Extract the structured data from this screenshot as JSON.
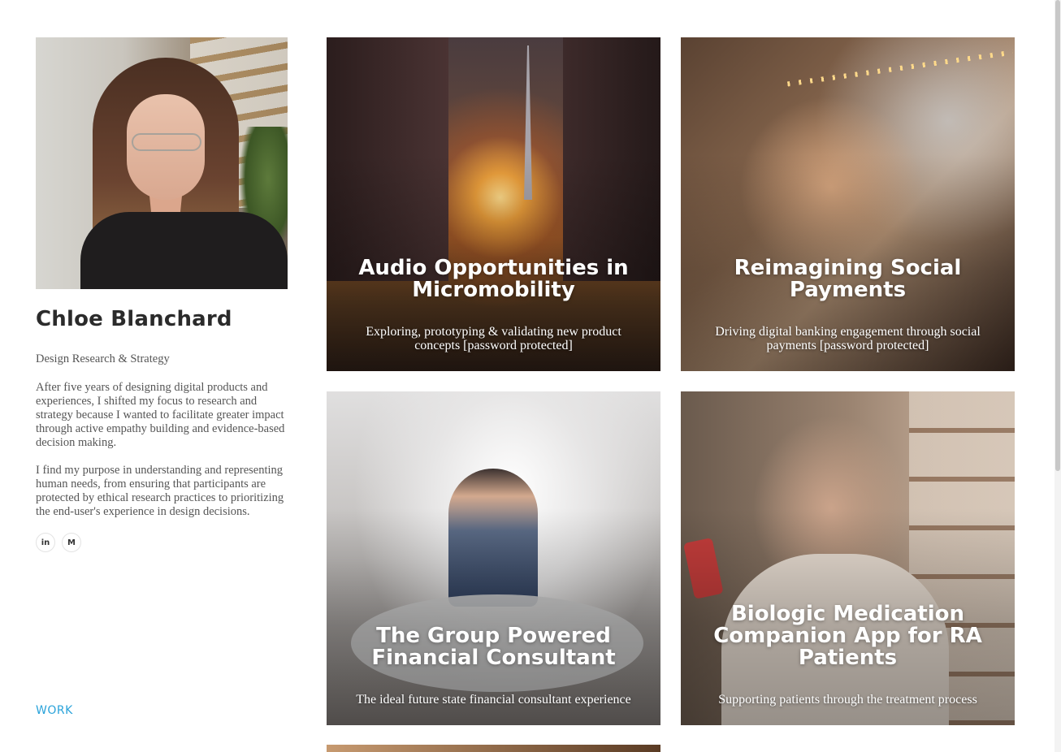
{
  "profile": {
    "name": "Chloe Blanchard",
    "role": "Design Research & Strategy",
    "bio": [
      "After five years of designing digital products and experiences, I shifted my focus to research and strategy because I wanted to facilitate greater impact through active empathy building and evidence-based decision making.",
      "I find my purpose in understanding and representing human needs, from ensuring that participants are protected by ethical research practices to prioritizing the end-user's experience in design decisions."
    ],
    "social": [
      {
        "icon": "linkedin-icon",
        "glyph": "in"
      },
      {
        "icon": "medium-icon",
        "glyph": "M"
      }
    ]
  },
  "nav": {
    "work": "WORK",
    "active_color": "#2aa3da"
  },
  "projects": [
    {
      "title": "Audio Opportunities in Micromobility",
      "subtitle": "Exploring, prototyping & validating new product concepts [password protected]"
    },
    {
      "title": "Reimagining Social Payments",
      "subtitle": "Driving digital banking engagement through social payments [password protected]"
    },
    {
      "title": "The Group Powered Financial Consultant",
      "subtitle": "The ideal future state financial consultant experience"
    },
    {
      "title": "Biologic Medication Companion App for RA Patients",
      "subtitle": "Supporting patients through the treatment process"
    }
  ]
}
